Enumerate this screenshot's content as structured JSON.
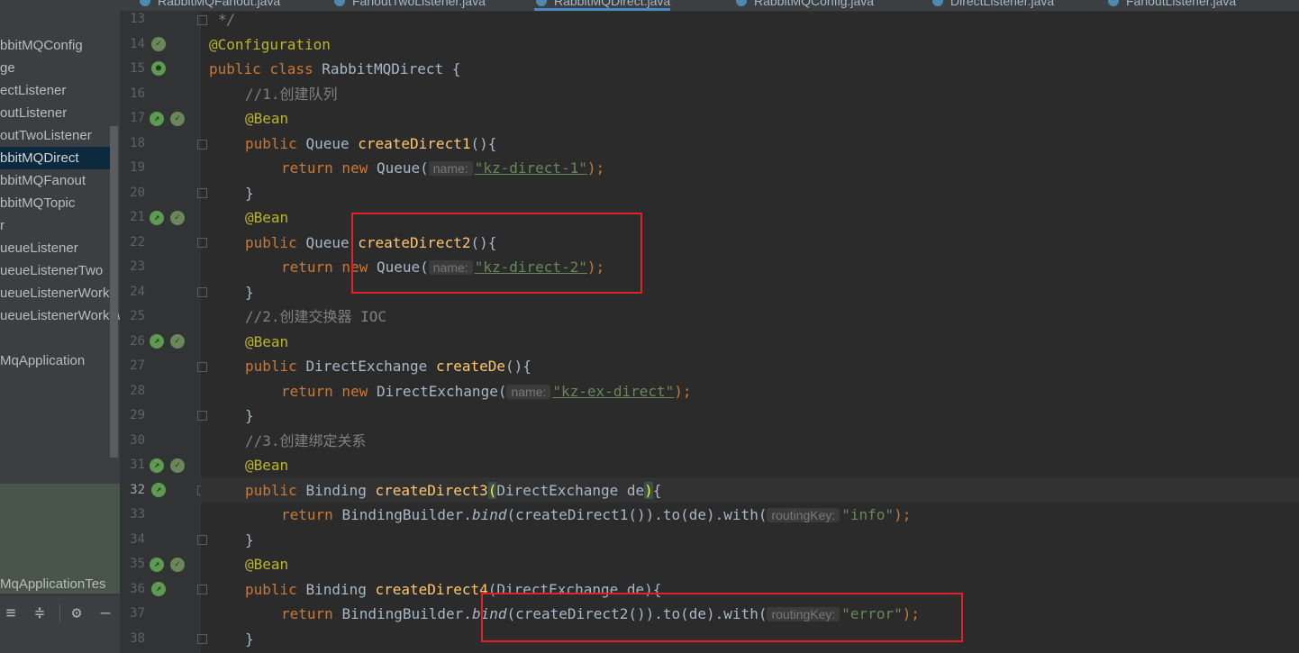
{
  "tabs": [
    {
      "label": "RabbitMQFanout.java"
    },
    {
      "label": "FanoutTwoListener.java"
    },
    {
      "label": "RabbitMQDirect.java"
    },
    {
      "label": "RabbitMQConfig.java"
    },
    {
      "label": "DirectListener.java"
    },
    {
      "label": "FanoutListener.java"
    }
  ],
  "project_tree": [
    "bbitMQConfig",
    "ge",
    "ectListener",
    "outListener",
    "outTwoListener",
    "bbitMQDirect",
    "bbitMQFanout",
    "bbitMQTopic",
    "r",
    "ueueListener",
    "ueueListenerTwo",
    "ueueListenerWork",
    "ueueListenerWorkTw",
    "MqApplication",
    "MqApplicationTes"
  ],
  "selected_tree_item": "bbitMQDirect",
  "line_numbers": [
    "13",
    "14",
    "15",
    "16",
    "17",
    "18",
    "19",
    "20",
    "21",
    "22",
    "23",
    "24",
    "25",
    "26",
    "27",
    "28",
    "29",
    "30",
    "31",
    "32",
    "33",
    "34",
    "35",
    "36",
    "37",
    "38"
  ],
  "current_line": "32",
  "code": {
    "l13": "*/",
    "l14_ann": "@Configuration",
    "l15_kw": "public class ",
    "l15_name": "RabbitMQDirect {",
    "l16": "//1.创建队列",
    "bean": "@Bean",
    "l18_kw": "public ",
    "l18_type": "Queue ",
    "l18_fn": "createDirect1",
    "paren_open_brace": "(){",
    "return_new": "return new ",
    "queue_open": "Queue(",
    "hint_name": "name:",
    "str_direct1": "\"kz-direct-1\"",
    "close_semicolon": ");",
    "rbrace": "}",
    "l22_fn": "createDirect2",
    "str_direct2": "\"kz-direct-2\"",
    "l25": "//2.创建交换器 IOC",
    "type_direct_exchange": "DirectExchange ",
    "l27_fn": "createDe",
    "direct_exchange_open": "DirectExchange(",
    "str_ex": "\"kz-ex-direct\"",
    "l30": "//3.创建绑定关系",
    "type_binding": "Binding ",
    "l32_fn": "createDirect3",
    "lparen": "(",
    "param_de": "DirectExchange de",
    "rparen": ")",
    "lbrace": "{",
    "return": "return ",
    "binding_builder": "BindingBuilder.",
    "bind": "bind",
    "l33_args": "(createDirect1()).to(de).with(",
    "hint_routing": "routingKey:",
    "str_info": "\"info\"",
    "l36_fn": "createDirect4",
    "l36_params": "(DirectExchange de){",
    "l37_args": "(createDirect2()).to(de).with(",
    "str_error": "\"error\""
  },
  "colors": {
    "editor_bg": "#2b2b2b",
    "keyword": "#cc7832",
    "annotation": "#bbb529",
    "function": "#ffc66d",
    "string": "#6a8759",
    "comment": "#808080",
    "highlight_box": "#e0202a"
  }
}
